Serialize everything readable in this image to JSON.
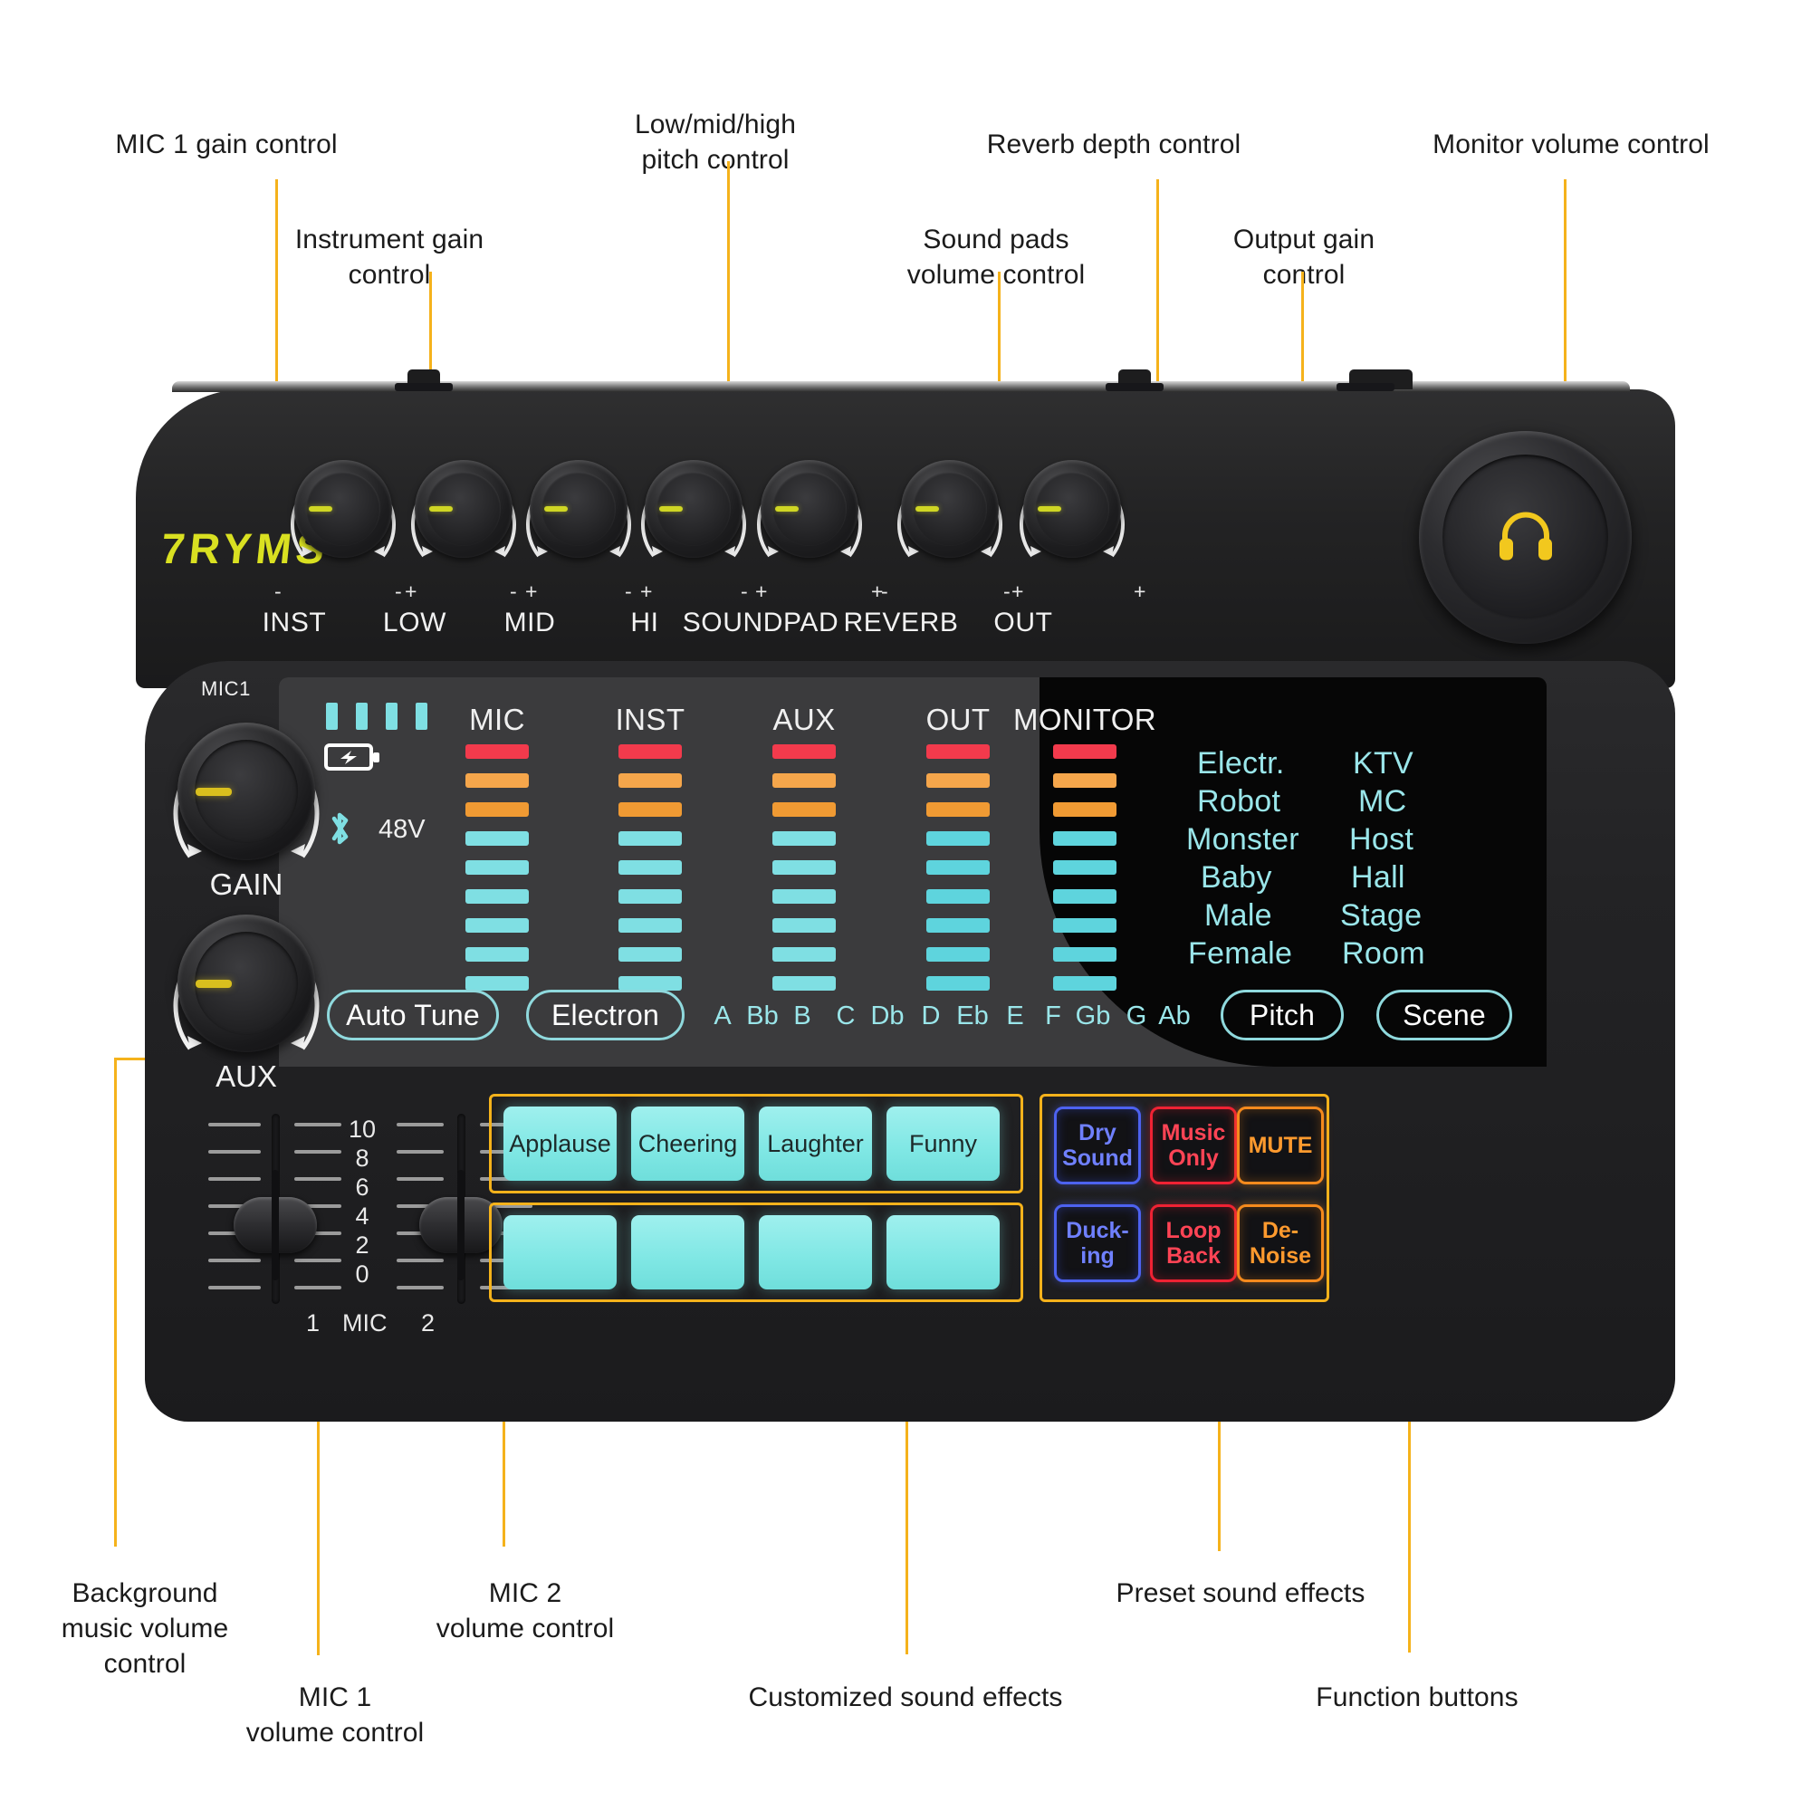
{
  "brand": "7RYMS",
  "callouts": [
    {
      "id": "mic1-gain",
      "text": "MIC 1 gain control"
    },
    {
      "id": "instrument",
      "text": "Instrument gain\ncontrol"
    },
    {
      "id": "pitch",
      "text": "Low/mid/high\npitch control"
    },
    {
      "id": "soundpad-vol",
      "text": "Sound pads\nvolume control"
    },
    {
      "id": "reverb",
      "text": "Reverb depth control"
    },
    {
      "id": "out-gain",
      "text": "Output gain\ncontrol"
    },
    {
      "id": "monitor-vol",
      "text": "Monitor volume control"
    },
    {
      "id": "bgm",
      "text": "Background\nmusic volume\ncontrol"
    },
    {
      "id": "mic1-vol",
      "text": "MIC 1\nvolume control"
    },
    {
      "id": "mic2-vol",
      "text": "MIC 2\nvolume control"
    },
    {
      "id": "custom-fx",
      "text": "Customized sound effects"
    },
    {
      "id": "preset-fx",
      "text": "Preset sound effects"
    },
    {
      "id": "func-btn",
      "text": "Function buttons"
    }
  ],
  "top_knobs": [
    {
      "label": "INST"
    },
    {
      "label": "LOW"
    },
    {
      "label": "MID"
    },
    {
      "label": "HI"
    },
    {
      "label": "SOUNDPAD"
    },
    {
      "label": "REVERB"
    },
    {
      "label": "OUT"
    }
  ],
  "knob_marks": {
    "minus": "-",
    "plus": "+"
  },
  "headphone_icon": "headphone-icon",
  "panel": {
    "mic1_top_label": "MIC1",
    "gain_label": "GAIN",
    "aux_label": "AUX",
    "battery_icon": "battery-charging-icon",
    "bluetooth_icon": "bluetooth-icon",
    "phantom_label": "48V",
    "battery_bars": 4
  },
  "meters": {
    "columns": [
      "MIC",
      "INST",
      "AUX",
      "OUT",
      "MONITOR"
    ],
    "segments": [
      "red",
      "orange",
      "orange2",
      "cyan",
      "cyan",
      "cyan",
      "cyan",
      "cyan",
      "cyan"
    ]
  },
  "presets": {
    "col1": [
      "Electr.",
      "Robot",
      "Monster",
      "Baby",
      "Male",
      "Female"
    ],
    "col2": [
      "KTV",
      "MC",
      "Host",
      "Hall",
      "Stage",
      "Room"
    ]
  },
  "pills": {
    "auto_tune": "Auto Tune",
    "electron": "Electron",
    "pitch": "Pitch",
    "scene": "Scene"
  },
  "notes": [
    "A",
    "Bb",
    "B",
    "C",
    "Db",
    "D",
    "Eb",
    "E",
    "F",
    "Gb",
    "G",
    "Ab"
  ],
  "faders": {
    "scale": [
      "10",
      "8",
      "6",
      "4",
      "2",
      "0"
    ],
    "left_label": "1",
    "mid_label": "MIC",
    "right_label": "2"
  },
  "sound_pads": {
    "row1": [
      "Applause",
      "Cheering",
      "Laughter",
      "Funny"
    ],
    "row2": [
      "",
      "",
      "",
      ""
    ]
  },
  "function_buttons": [
    {
      "label": "Dry\nSound",
      "color": "blue"
    },
    {
      "label": "Music\nOnly",
      "color": "red"
    },
    {
      "label": "MUTE",
      "color": "orange"
    },
    {
      "label": "Duck-\ning",
      "color": "blue"
    },
    {
      "label": "Loop\nBack",
      "color": "red"
    },
    {
      "label": "De-\nNoise",
      "color": "orange"
    }
  ],
  "colors": {
    "accent": "#f5b21b",
    "cyan": "#7fdfe3",
    "brand_yellow": "#d9e021",
    "red": "#f23a4c",
    "orange": "#f5a64b"
  }
}
